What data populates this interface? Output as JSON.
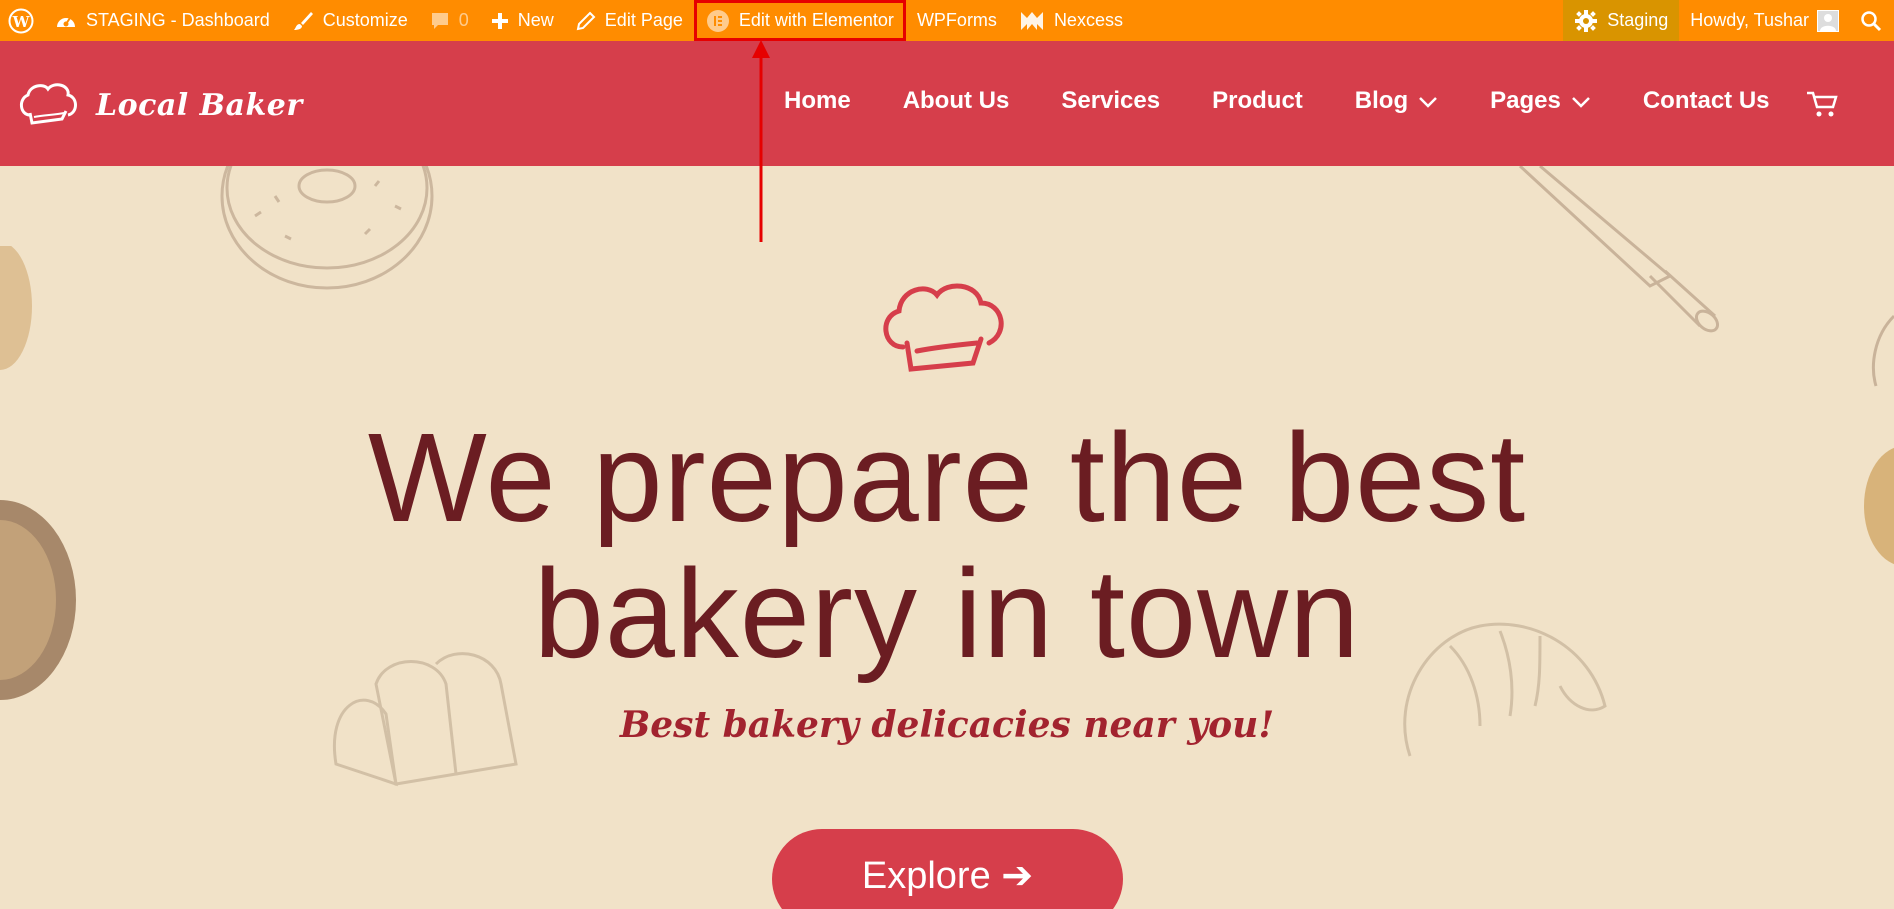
{
  "adminbar": {
    "site_name": "STAGING - Dashboard",
    "customize": "Customize",
    "comments_count": "0",
    "new": "New",
    "edit_page": "Edit Page",
    "edit_elementor": "Edit with Elementor",
    "wpforms": "WPForms",
    "nexcess": "Nexcess",
    "staging": "Staging",
    "howdy": "Howdy, Tushar",
    "icons": [
      "wordpress-icon",
      "dashboard-icon",
      "brush-icon",
      "comment-icon",
      "plus-icon",
      "pencil-icon",
      "elementor-icon",
      "nexcess-icon",
      "gear-icon",
      "avatar",
      "search-icon"
    ]
  },
  "header": {
    "logo_text": "Local Baker",
    "nav": [
      {
        "label": "Home"
      },
      {
        "label": "About Us"
      },
      {
        "label": "Services"
      },
      {
        "label": "Product"
      },
      {
        "label": "Blog"
      },
      {
        "label": "Pages"
      },
      {
        "label": "Contact Us"
      }
    ]
  },
  "hero": {
    "headline_line1": "We prepare the best",
    "headline_line2": "bakery in town",
    "tagline": "Best bakery delicacies near you!",
    "button": "Explore ➔"
  },
  "colors": {
    "adminbar": "#ff8c00",
    "header": "#d63e4b",
    "hero_bg": "#f1e2c8",
    "headline": "#6b1d22",
    "highlight_box": "#e60000"
  }
}
